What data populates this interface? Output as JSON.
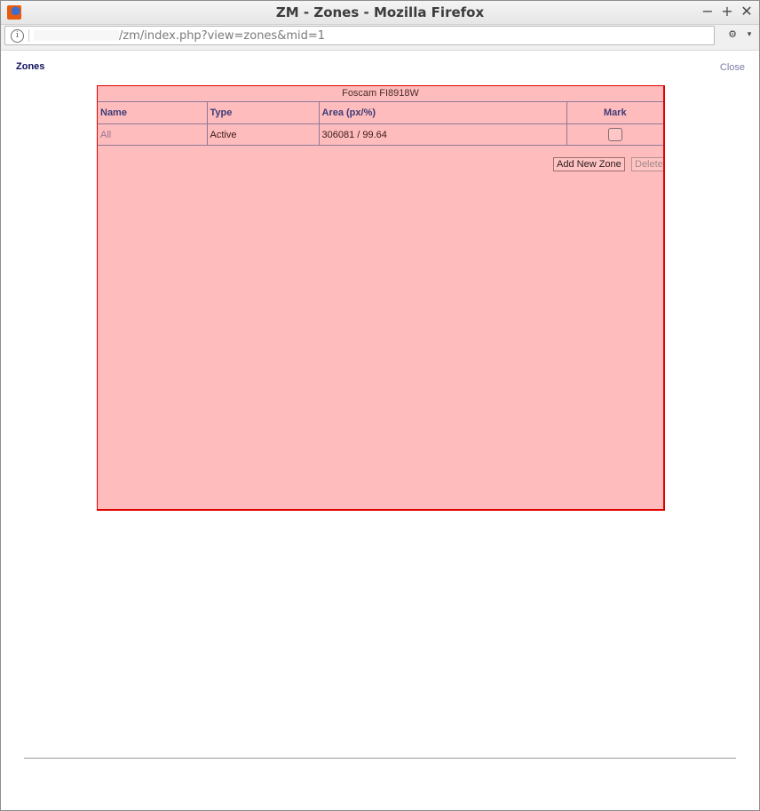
{
  "window": {
    "title": "ZM - Zones - Mozilla Firefox",
    "minimize_glyph": "−",
    "maximize_glyph": "+",
    "close_glyph": "✕",
    "icon": "firefox-icon"
  },
  "urlbar": {
    "info_glyph": "i",
    "url_visible": "/zm/index.php?view=zones&mid=1",
    "extension_icon": "puzzle-icon",
    "extension_glyph": "⚙",
    "menu_arrow_glyph": "▾"
  },
  "page": {
    "heading": "Zones",
    "close_label": "Close"
  },
  "monitor": {
    "name": "Foscam FI8918W",
    "background_color": "#ffbcbc",
    "border_color": "#e00000"
  },
  "zones_table": {
    "columns": [
      "Name",
      "Type",
      "Area (px/%)",
      "Mark"
    ],
    "rows": [
      {
        "name": "All",
        "type": "Active",
        "area": "306081 / 99.64",
        "marked": false
      }
    ]
  },
  "actions": {
    "add_new_zone": "Add New Zone",
    "delete": "Delete"
  }
}
